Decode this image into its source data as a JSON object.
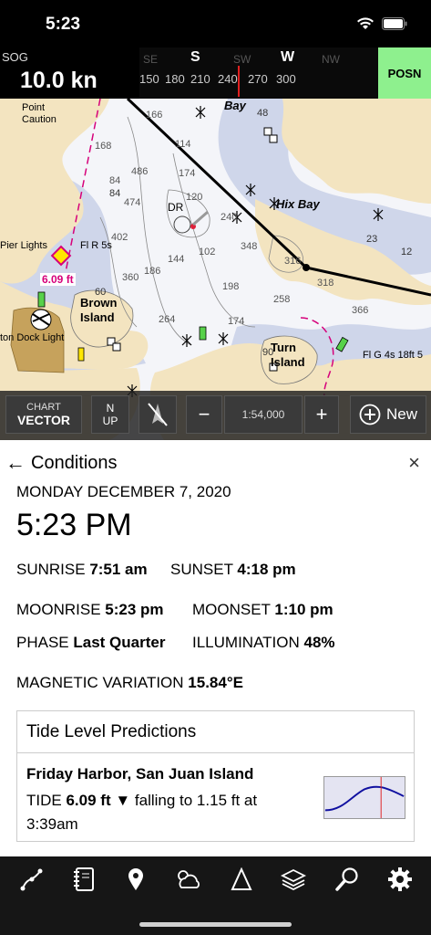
{
  "status_bar": {
    "time": "5:23"
  },
  "instruments": {
    "sog_label": "SOG",
    "sog_value": "10.0 kn",
    "compass": {
      "directions": [
        "SE",
        "S",
        "SW",
        "W",
        "NW"
      ],
      "degrees": [
        "150",
        "180",
        "210",
        "240",
        "270",
        "300"
      ]
    },
    "posn_label": "POSN"
  },
  "map": {
    "labels": {
      "point_caution": "Point Caution",
      "bay": "Bay",
      "hix_bay": "Hix Bay",
      "pier_lights": "Pier Lights",
      "fl_r": "Fl R 5s",
      "tide_value": "6.09 ft",
      "brown_island": "Brown Island",
      "dock_light": "ton Dock Light",
      "turn_island": "Turn Island",
      "fl_g": "Fl G 4s 18ft 5",
      "dr": "DR"
    },
    "soundings": [
      "166",
      "168",
      "486",
      "84",
      "474",
      "114",
      "174",
      "120",
      "402",
      "360",
      "186",
      "144",
      "102",
      "198",
      "240",
      "348",
      "316",
      "318",
      "258",
      "264",
      "174",
      "366",
      "23",
      "12",
      "48",
      "84",
      "60",
      "90"
    ],
    "scale": "1:54,000"
  },
  "map_toolbar": {
    "chart_label": "CHART",
    "chart_value": "VECTOR",
    "north_up_top": "N",
    "north_up_bottom": "UP",
    "zoom_out": "−",
    "zoom_in": "+",
    "scale": "1:54,000",
    "new_label": "New"
  },
  "conditions": {
    "title": "Conditions",
    "date": "MONDAY DECEMBER 7, 2020",
    "time": "5:23 PM",
    "sunrise_label": "SUNRISE",
    "sunrise_value": "7:51 am",
    "sunset_label": "SUNSET",
    "sunset_value": "4:18 pm",
    "moonrise_label": "MOONRISE",
    "moonrise_value": "5:23 pm",
    "moonset_label": "MOONSET",
    "moonset_value": "1:10 pm",
    "phase_label": "PHASE",
    "phase_value": "Last Quarter",
    "illumination_label": "ILLUMINATION",
    "illumination_value": "48%",
    "magvar_label": "MAGNETIC VARIATION",
    "magvar_value": "15.84°E"
  },
  "tide_card": {
    "title": "Tide Level Predictions",
    "station": "Friday Harbor, San Juan Island",
    "tide_label": "TIDE",
    "tide_value": "6.09 ft",
    "trend_text": "▼ falling to 1.15 ft at 3:39am"
  },
  "tabs": [
    "route-icon",
    "logbook-icon",
    "marker-icon",
    "weather-icon",
    "sail-icon",
    "layers-icon",
    "search-icon",
    "settings-icon"
  ],
  "colors": {
    "posn_bg": "#8ef08e",
    "land": "#f3e4c0",
    "shallow": "#cfd6ea",
    "route": "#000000",
    "magenta": "#d6007a"
  }
}
